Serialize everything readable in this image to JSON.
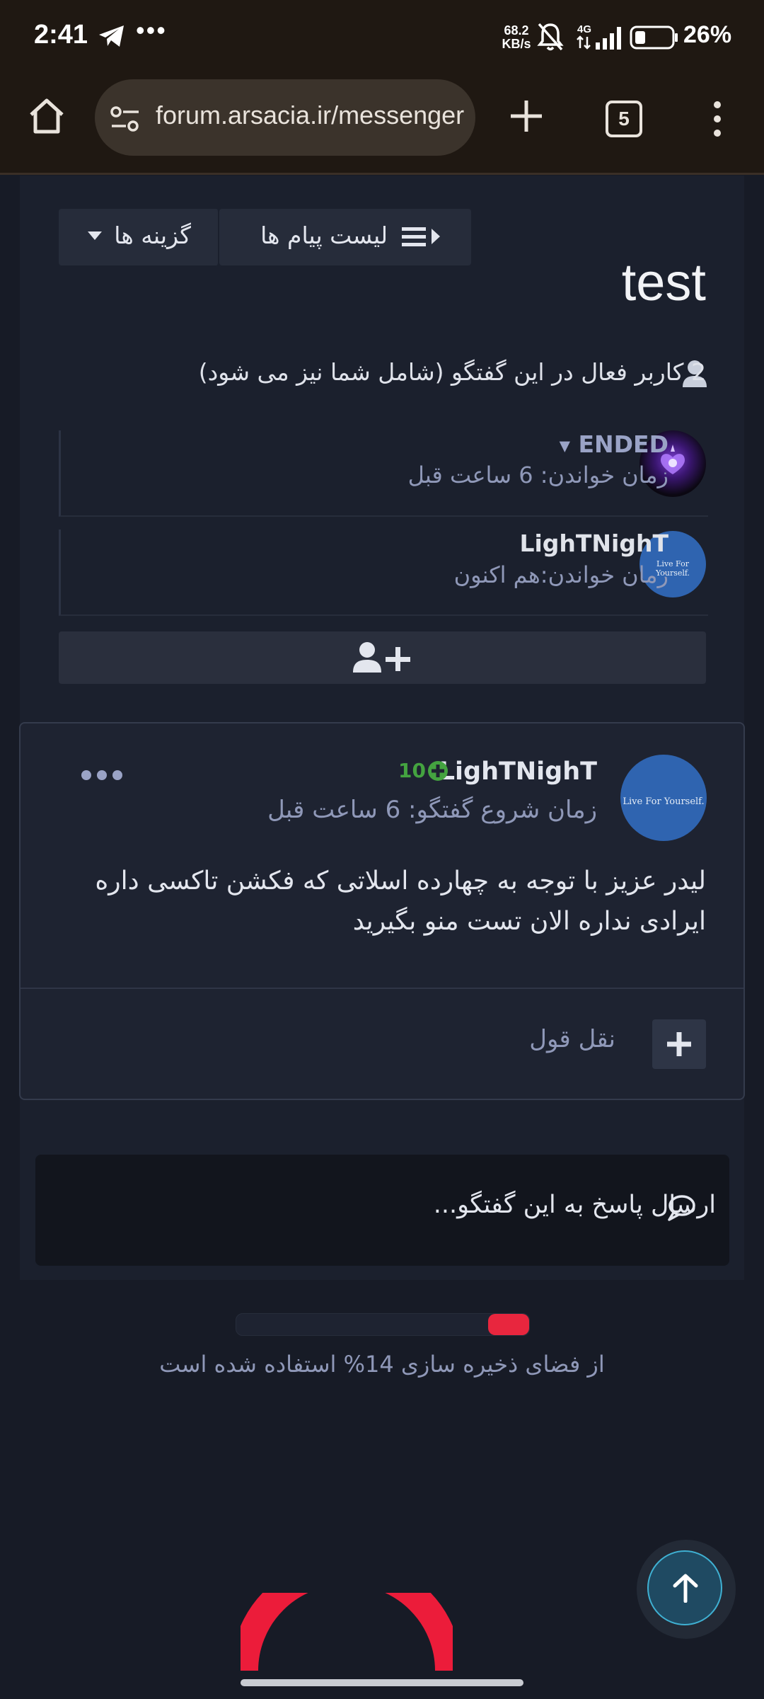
{
  "status_bar": {
    "time": "2:41",
    "net_speed_value": "68.2",
    "net_speed_unit": "KB/s",
    "network_type": "4G",
    "battery_percent": "26%",
    "overflow_dots": "•••"
  },
  "browser": {
    "url": "forum.arsacia.ir/messenger",
    "tab_count": "5"
  },
  "toolbar": {
    "message_list_label": "لیست پیام ها",
    "options_label": "گزینه ها"
  },
  "conversation": {
    "title": "test",
    "participants_text": "2 کاربر فعال در این گفتگو (شامل شما نیز می شود)"
  },
  "members": [
    {
      "name": "ENDED",
      "read_time": "زمان خواندن: 6 ساعت قبل"
    },
    {
      "name": "LighTNighT",
      "read_time": "زمان خواندن:هم اکنون",
      "avatar_text": "Live For Yourself."
    }
  ],
  "message": {
    "author": "LighTNighT",
    "reputation": "10",
    "started": "زمان شروع گفتگو: 6 ساعت قبل",
    "body": "لیدر عزیز با توجه به چهارده اسلاتی که فکشن تاکسی داره ایرادی نداره الان تست منو بگیرید",
    "avatar_text": "Live For Yourself.",
    "quote_label": "نقل قول"
  },
  "reply": {
    "placeholder": "ارسال پاسخ به این گفتگو..."
  },
  "storage": {
    "used_fraction": 0.14,
    "text": "از فضای ذخیره سازی 14% استفاده شده است"
  },
  "colors": {
    "accent_red": "#e8263e",
    "reputation_green": "#44a340",
    "avatar_blue": "#2f64b0",
    "scroll_button_ring": "#3fb0d2"
  }
}
